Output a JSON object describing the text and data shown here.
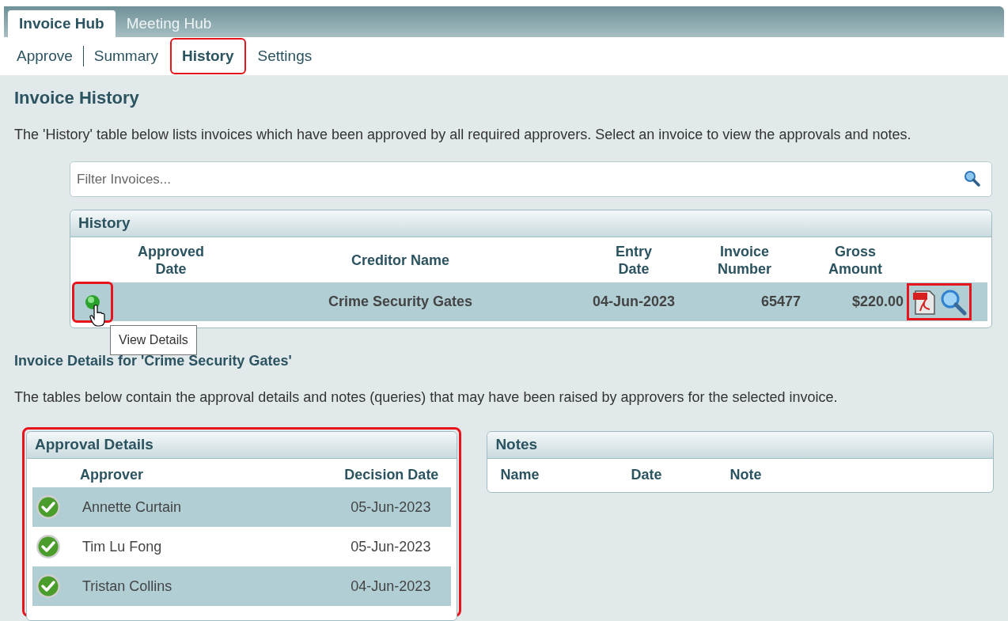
{
  "hub_tabs": [
    {
      "label": "Invoice Hub",
      "selected": true
    },
    {
      "label": "Meeting Hub",
      "selected": false
    }
  ],
  "nav": [
    {
      "label": "Approve",
      "selected": false,
      "highlighted": false
    },
    {
      "label": "Summary",
      "selected": false,
      "highlighted": false
    },
    {
      "label": "History",
      "selected": true,
      "highlighted": true
    },
    {
      "label": "Settings",
      "selected": false,
      "highlighted": false
    }
  ],
  "page_title": "Invoice History",
  "intro": "The 'History' table below lists invoices which have been approved by all required approvers. Select an invoice to view the approvals and notes.",
  "filter": {
    "placeholder": "Filter Invoices..."
  },
  "history": {
    "title": "History",
    "columns": [
      "Approved Date",
      "Creditor Name",
      "Entry Date",
      "Invoice Number",
      "Gross Amount"
    ],
    "rows": [
      {
        "creditor": "Crime Security Gates",
        "entry_date": "04-Jun-2023",
        "invoice_number": "65477",
        "gross_amount": "$220.00",
        "selected": true
      }
    ],
    "tooltip": "View Details"
  },
  "details_title": "Invoice Details for 'Crime Security Gates'",
  "details_intro": "The tables below contain the approval details and notes (queries) that may have been raised by approvers for the selected invoice.",
  "approval": {
    "title": "Approval Details",
    "columns": [
      "Approver",
      "Decision Date"
    ],
    "rows": [
      {
        "approver": "Annette Curtain",
        "date": "05-Jun-2023",
        "approved": true
      },
      {
        "approver": "Tim Lu Fong",
        "date": "05-Jun-2023",
        "approved": true
      },
      {
        "approver": "Tristan Collins",
        "date": "04-Jun-2023",
        "approved": true
      }
    ]
  },
  "notes": {
    "title": "Notes",
    "columns": [
      "Name",
      "Date",
      "Note"
    ]
  }
}
